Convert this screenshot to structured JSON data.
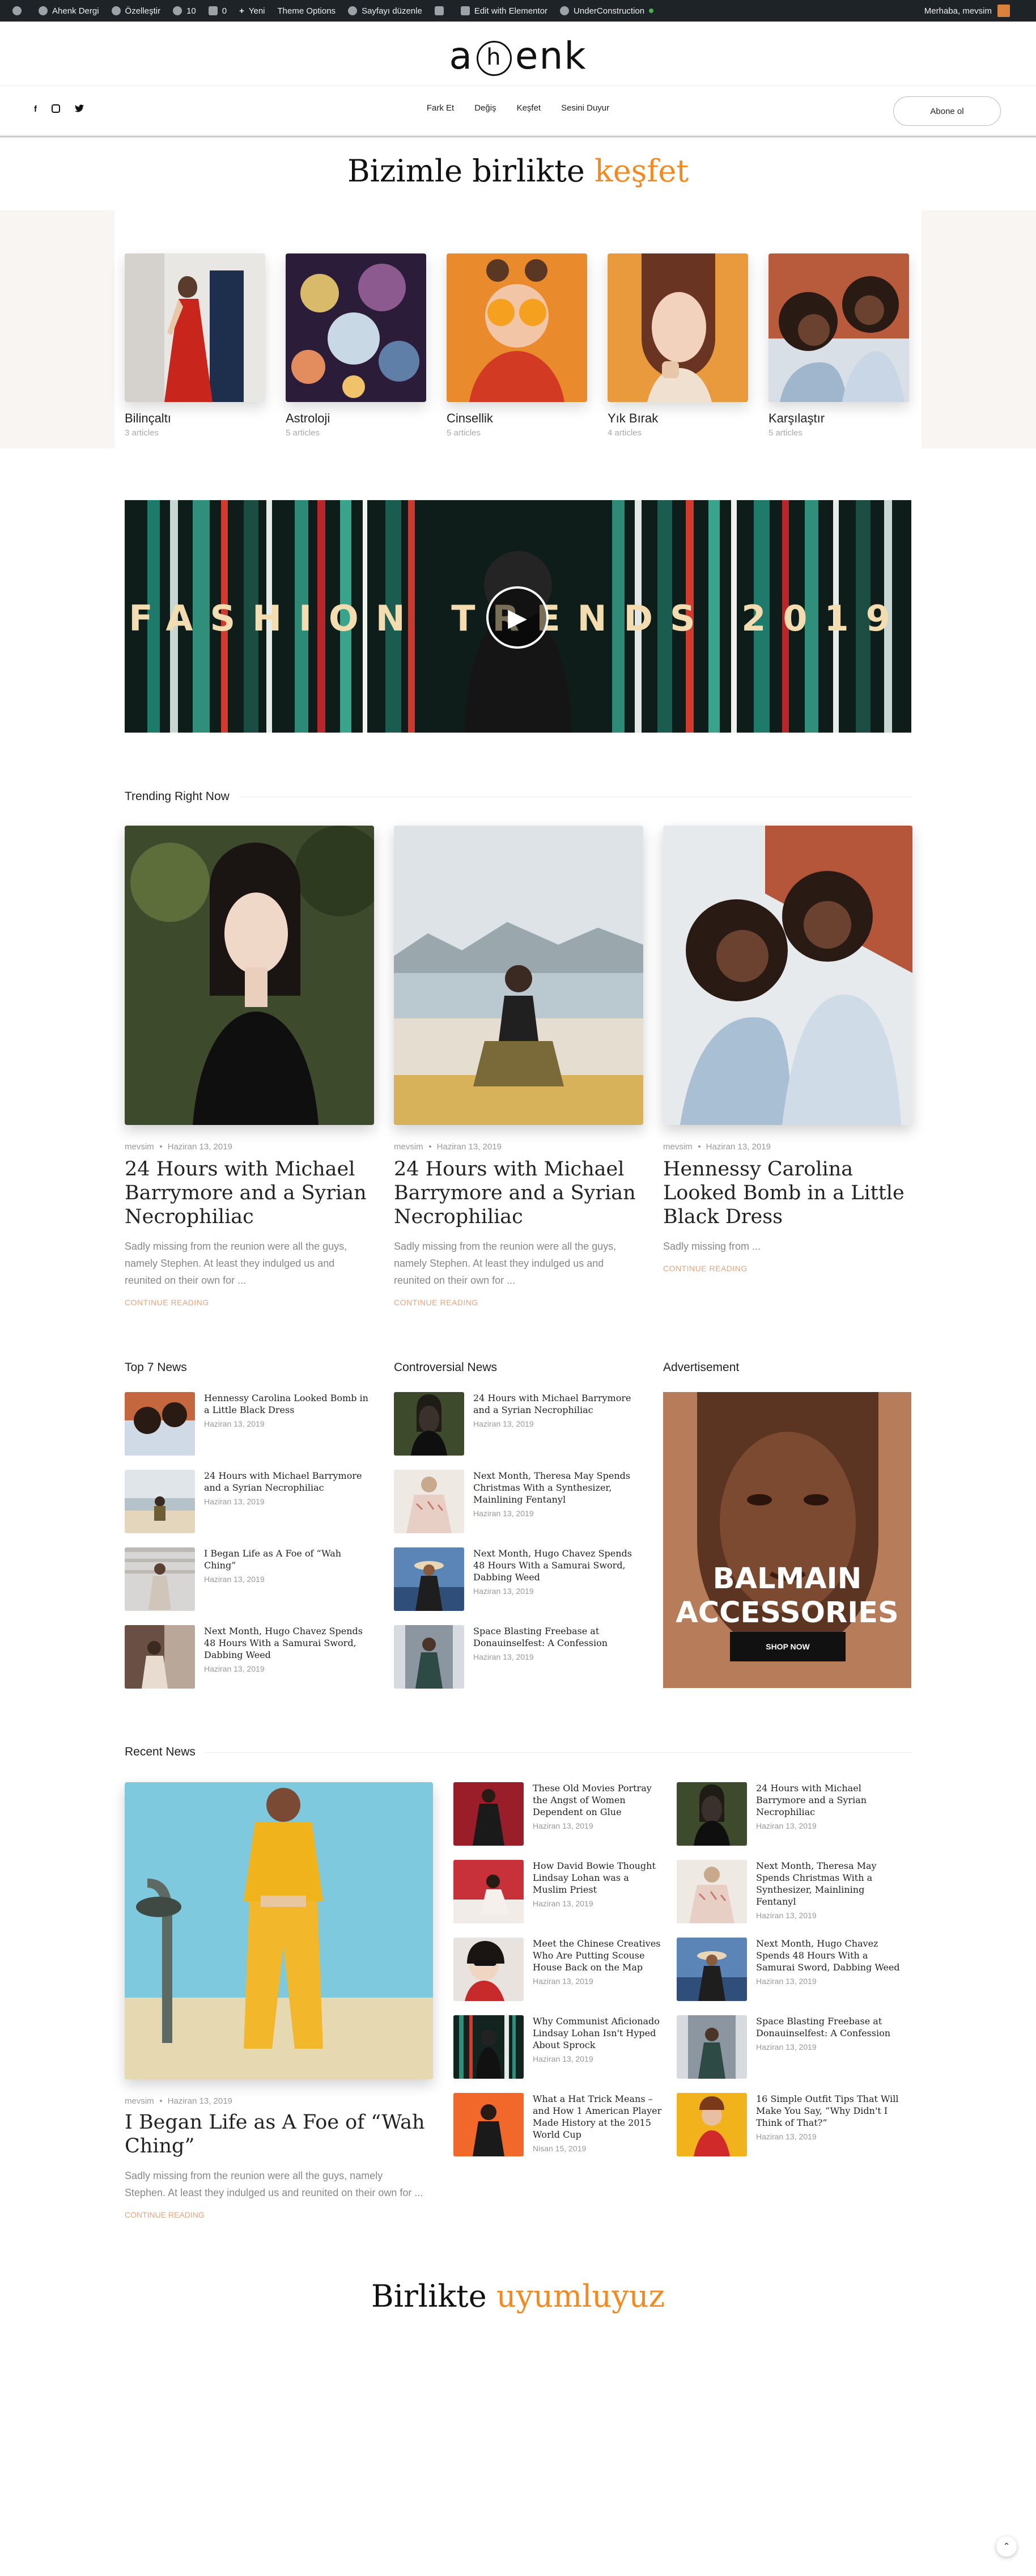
{
  "adminbar": {
    "site": "Ahenk Dergi",
    "customize": "Özelleştir",
    "updates": "10",
    "comments": "0",
    "new": "Yeni",
    "theme_options": "Theme Options",
    "edit_page": "Sayfayı düzenle",
    "elementor": "Edit with Elementor",
    "under_construction": "UnderConstruction",
    "greeting": "Merhaba, mevsim"
  },
  "header": {
    "logo_left": "a",
    "logo_circle": "h",
    "logo_right": "enk",
    "nav": [
      "Fark Et",
      "Değiş",
      "Keşfet",
      "Sesini Duyur"
    ],
    "subscribe": "Abone ol",
    "social": [
      "facebook-icon",
      "instagram-icon",
      "twitter-icon"
    ]
  },
  "explore": {
    "heading": "Bizimle birlikte",
    "heading_accent": "keşfet",
    "accent_color": "#f28a20",
    "categories": [
      {
        "name": "Bilinçaltı",
        "count": "3 articles"
      },
      {
        "name": "Astroloji",
        "count": "5 articles"
      },
      {
        "name": "Cinsellik",
        "count": "5 articles"
      },
      {
        "name": "Yık Bırak",
        "count": "4 articles"
      },
      {
        "name": "Karşılaştır",
        "count": "5 articles"
      }
    ]
  },
  "video": {
    "title": "FASHION TRENDS 2019"
  },
  "trending": {
    "title": "Trending Right Now",
    "posts": [
      {
        "author": "mevsim",
        "date": "Haziran 13, 2019",
        "title": "24 Hours with Michael Barrymore and a Syrian Necrophiliac",
        "excerpt": "Sadly missing from the reunion were all the guys, namely Stephen. At least they indulged us and reunited on their own for ...",
        "more": "CONTINUE READING"
      },
      {
        "author": "mevsim",
        "date": "Haziran 13, 2019",
        "title": "24 Hours with Michael Barrymore and a Syrian Necrophiliac",
        "excerpt": "Sadly missing from the reunion were all the guys, namely Stephen. At least they indulged us and reunited on their own for ...",
        "more": "CONTINUE READING"
      },
      {
        "author": "mevsim",
        "date": "Haziran 13, 2019",
        "title": "Hennessy Carolina Looked Bomb in a Little Black Dress",
        "excerpt": "Sadly missing from ...",
        "more": "CONTINUE READING"
      }
    ]
  },
  "top7": {
    "title": "Top 7 News",
    "items": [
      {
        "title": "Hennessy Carolina Looked Bomb in a Little Black Dress",
        "date": "Haziran 13, 2019"
      },
      {
        "title": "24 Hours with Michael Barrymore and a Syrian Necrophiliac",
        "date": "Haziran 13, 2019"
      },
      {
        "title": "I Began Life as A Foe of “Wah Ching”",
        "date": "Haziran 13, 2019"
      },
      {
        "title": "Next Month, Hugo Chavez Spends 48 Hours With a Samurai Sword, Dabbing Weed",
        "date": "Haziran 13, 2019"
      }
    ]
  },
  "controversial": {
    "title": "Controversial News",
    "items": [
      {
        "title": "24 Hours with Michael Barrymore and a Syrian Necrophiliac",
        "date": "Haziran 13, 2019"
      },
      {
        "title": "Next Month, Theresa May Spends Christmas With a Synthesizer, Mainlining Fentanyl",
        "date": "Haziran 13, 2019"
      },
      {
        "title": "Next Month, Hugo Chavez Spends 48 Hours With a Samurai Sword, Dabbing Weed",
        "date": "Haziran 13, 2019"
      },
      {
        "title": "Space Blasting Freebase at Donauinselfest: A Confession",
        "date": "Haziran 13, 2019"
      }
    ]
  },
  "advert": {
    "title": "Advertisement",
    "headline_1": "BALMAIN",
    "headline_2": "ACCESSORIES",
    "button": "SHOP NOW"
  },
  "recent": {
    "title": "Recent News",
    "main": {
      "author": "mevsim",
      "date": "Haziran 13, 2019",
      "title": "I Began Life as A Foe of “Wah Ching”",
      "excerpt": "Sadly missing from the reunion were all the guys, namely Stephen. At least they indulged us and reunited on their own for ...",
      "more": "CONTINUE READING"
    },
    "middle": [
      {
        "title": "These Old Movies Portray the Angst of Women Dependent on Glue",
        "date": "Haziran 13, 2019"
      },
      {
        "title": "How David Bowie Thought Lindsay Lohan was a Muslim Priest",
        "date": "Haziran 13, 2019"
      },
      {
        "title": "Meet the Chinese Creatives Who Are Putting Scouse House Back on the Map",
        "date": "Haziran 13, 2019"
      },
      {
        "title": "Why Communist Aficionado Lindsay Lohan Isn't Hyped About Sprock",
        "date": "Haziran 13, 2019"
      },
      {
        "title": "What a Hat Trick Means – and How 1 American Player Made History at the 2015 World Cup",
        "date": "Nisan 15, 2019"
      }
    ],
    "right": [
      {
        "title": "24 Hours with Michael Barrymore and a Syrian Necrophiliac",
        "date": "Haziran 13, 2019"
      },
      {
        "title": "Next Month, Theresa May Spends Christmas With a Synthesizer, Mainlining Fentanyl",
        "date": "Haziran 13, 2019"
      },
      {
        "title": "Next Month, Hugo Chavez Spends 48 Hours With a Samurai Sword, Dabbing Weed",
        "date": "Haziran 13, 2019"
      },
      {
        "title": "Space Blasting Freebase at Donauinselfest: A Confession",
        "date": "Haziran 13, 2019"
      },
      {
        "title": "16 Simple Outfit Tips That Will Make You Say, “Why Didn't I Think of That?”",
        "date": "Haziran 13, 2019"
      }
    ]
  },
  "together": {
    "heading": "Birlikte",
    "heading_accent": "uyumluyuz"
  }
}
